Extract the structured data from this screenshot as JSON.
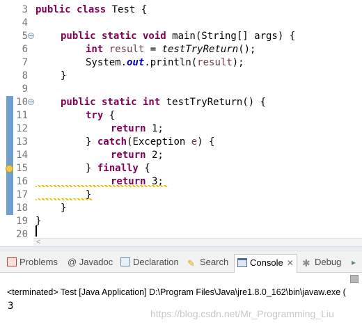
{
  "editor": {
    "lines": [
      {
        "num": "3"
      },
      {
        "num": "4"
      },
      {
        "num": "5"
      },
      {
        "num": "6"
      },
      {
        "num": "7"
      },
      {
        "num": "8"
      },
      {
        "num": "9"
      },
      {
        "num": "10"
      },
      {
        "num": "11"
      },
      {
        "num": "12"
      },
      {
        "num": "13"
      },
      {
        "num": "14"
      },
      {
        "num": "15"
      },
      {
        "num": "16"
      },
      {
        "num": "17"
      },
      {
        "num": "18"
      },
      {
        "num": "19"
      },
      {
        "num": "20"
      }
    ],
    "code": {
      "l3_kw": "public class",
      "l3_rest": " Test {",
      "l5_kw": "public static void",
      "l5_rest": " main(String[] args) {",
      "l6_kw": "int",
      "l6_var": " result",
      "l6_eq": " = ",
      "l6_call": "testTryReturn",
      "l6_end": "();",
      "l7_start": "System.",
      "l7_field": "out",
      "l7_mid": ".println(",
      "l7_var": "result",
      "l7_end": ");",
      "l8": "}",
      "l10_kw": "public static int",
      "l10_rest": " testTryReturn() {",
      "l11_kw": "try",
      "l11_rest": " {",
      "l12_kw": "return",
      "l12_rest": " 1;",
      "l13_start": "} ",
      "l13_kw": "catch",
      "l13_mid": "(Exception ",
      "l13_var": "e",
      "l13_end": ") {",
      "l14_kw": "return",
      "l14_rest": " 2;",
      "l15_start": "} ",
      "l15_kw": "finally",
      "l15_rest": " {",
      "l16_kw": "return",
      "l16_rest": " 3;",
      "l17": "}",
      "l18": "}",
      "l19": "}"
    },
    "scroll_left_arrow": "<"
  },
  "views": {
    "tabs": [
      {
        "label": "Problems",
        "icon": "problems-icon"
      },
      {
        "label": "@ Javadoc",
        "icon": "javadoc-icon"
      },
      {
        "label": "Declaration",
        "icon": "declaration-icon"
      },
      {
        "label": "Search",
        "icon": "search-icon"
      },
      {
        "label": "Console",
        "icon": "console-icon",
        "active": true,
        "close": "✕"
      },
      {
        "label": "Debug",
        "icon": "debug-icon"
      }
    ]
  },
  "console": {
    "status": "<terminated> Test [Java Application] D:\\Program Files\\Java\\jre1.8.0_162\\bin\\javaw.exe (",
    "output": "3"
  },
  "watermark": "https://blog.csdn.net/Mr_Programming_Liu",
  "colors": {
    "keyword": "#7f0055",
    "variable": "#6a3e3e",
    "field": "#0000c0",
    "gutter_marker": "#6f9fd0"
  }
}
